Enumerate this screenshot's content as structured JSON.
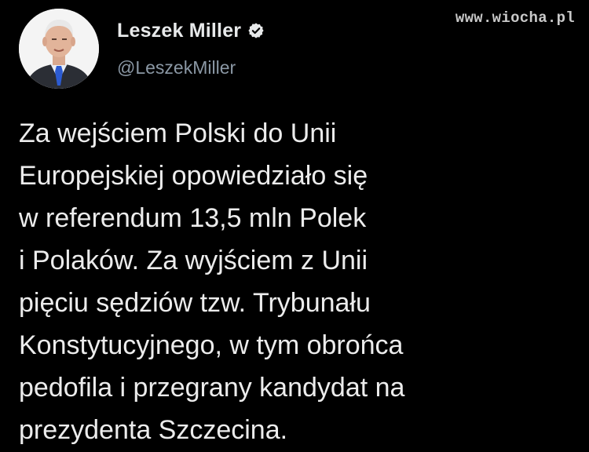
{
  "author": {
    "display_name": "Leszek Miller",
    "handle": "@LeszekMiller",
    "verified_icon": "verified-badge-icon",
    "avatar_icon": "profile-photo-avatar"
  },
  "tweet": {
    "lines": [
      "Za wejściem Polski do Unii",
      "Europejskiej opowiedziało się",
      "w referendum 13,5 mln Polek",
      "i Polaków. Za wyjściem z Unii",
      "pięciu sędziów tzw. Trybunału",
      "Konstytucyjnego, w tym obrońca",
      "pedofila i przegrany kandydat na",
      "prezydenta Szczecina."
    ]
  },
  "watermark": {
    "text": "www.wiocha.pl"
  },
  "colors": {
    "background": "#000000",
    "primary_text": "#e7e9ea",
    "secondary_text": "#8b98a5",
    "watermark": "#c9c9c9"
  }
}
